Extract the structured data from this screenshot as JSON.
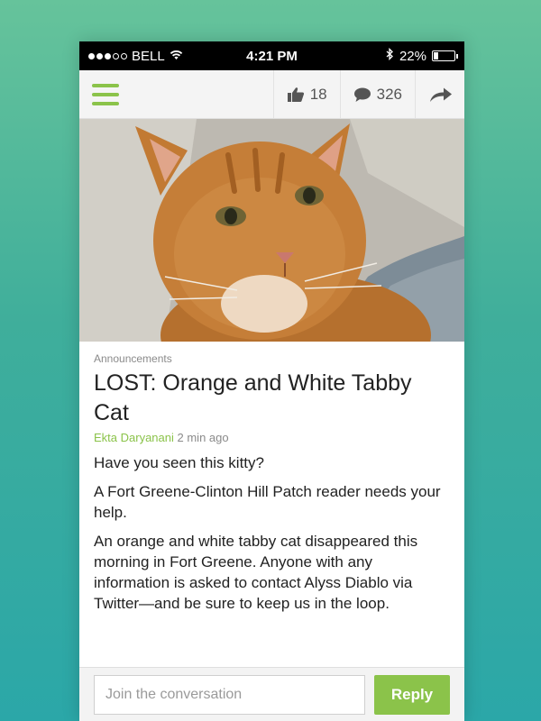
{
  "status_bar": {
    "carrier": "BELL",
    "time": "4:21 PM",
    "battery_text": "22%",
    "battery_level": 0.22,
    "signal_bars_filled": 3,
    "signal_bars_total": 5
  },
  "toolbar": {
    "menu_icon": "hamburger-icon",
    "like_count": "18",
    "comment_count": "326",
    "share_icon": "share-arrow-icon"
  },
  "hero": {
    "image_subject": "orange tabby cat photo"
  },
  "article": {
    "category": "Announcements",
    "title": "LOST: Orange and White Tabby Cat",
    "author": "Ekta Daryanani",
    "time": "2 min ago",
    "paragraphs": [
      "Have you seen this kitty?",
      "A Fort Greene-Clinton Hill Patch reader needs your help.",
      "An orange and white tabby cat disappeared this morning in Fort Greene. Anyone with any information is asked to contact Alyss Diablo via Twitter—and be sure to keep us in the loop."
    ]
  },
  "reply": {
    "placeholder": "Join the conversation",
    "button_label": "Reply"
  },
  "colors": {
    "accent": "#8bc34a",
    "background_top": "#66c39b",
    "background_bottom": "#2ba7a8"
  }
}
